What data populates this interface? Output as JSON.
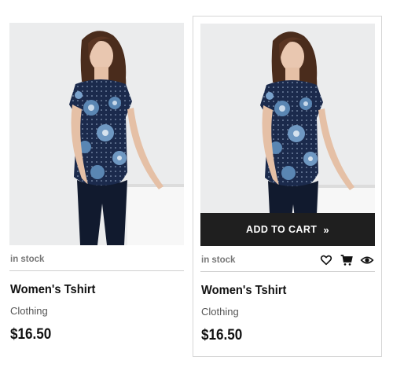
{
  "products": [
    {
      "stock": "in stock",
      "name": "Women's Tshirt",
      "category": "Clothing",
      "price": "$16.50"
    },
    {
      "stock": "in stock",
      "name": "Women's Tshirt",
      "category": "Clothing",
      "price": "$16.50",
      "add_to_cart_label": "ADD TO CART",
      "add_to_cart_arrow": "»",
      "actions": [
        "heart-icon",
        "cart-icon",
        "eye-icon"
      ]
    }
  ],
  "colors": {
    "bar": "#1f1f1f",
    "shirt": "#1b2a4c",
    "flower": "#5a86b3"
  }
}
